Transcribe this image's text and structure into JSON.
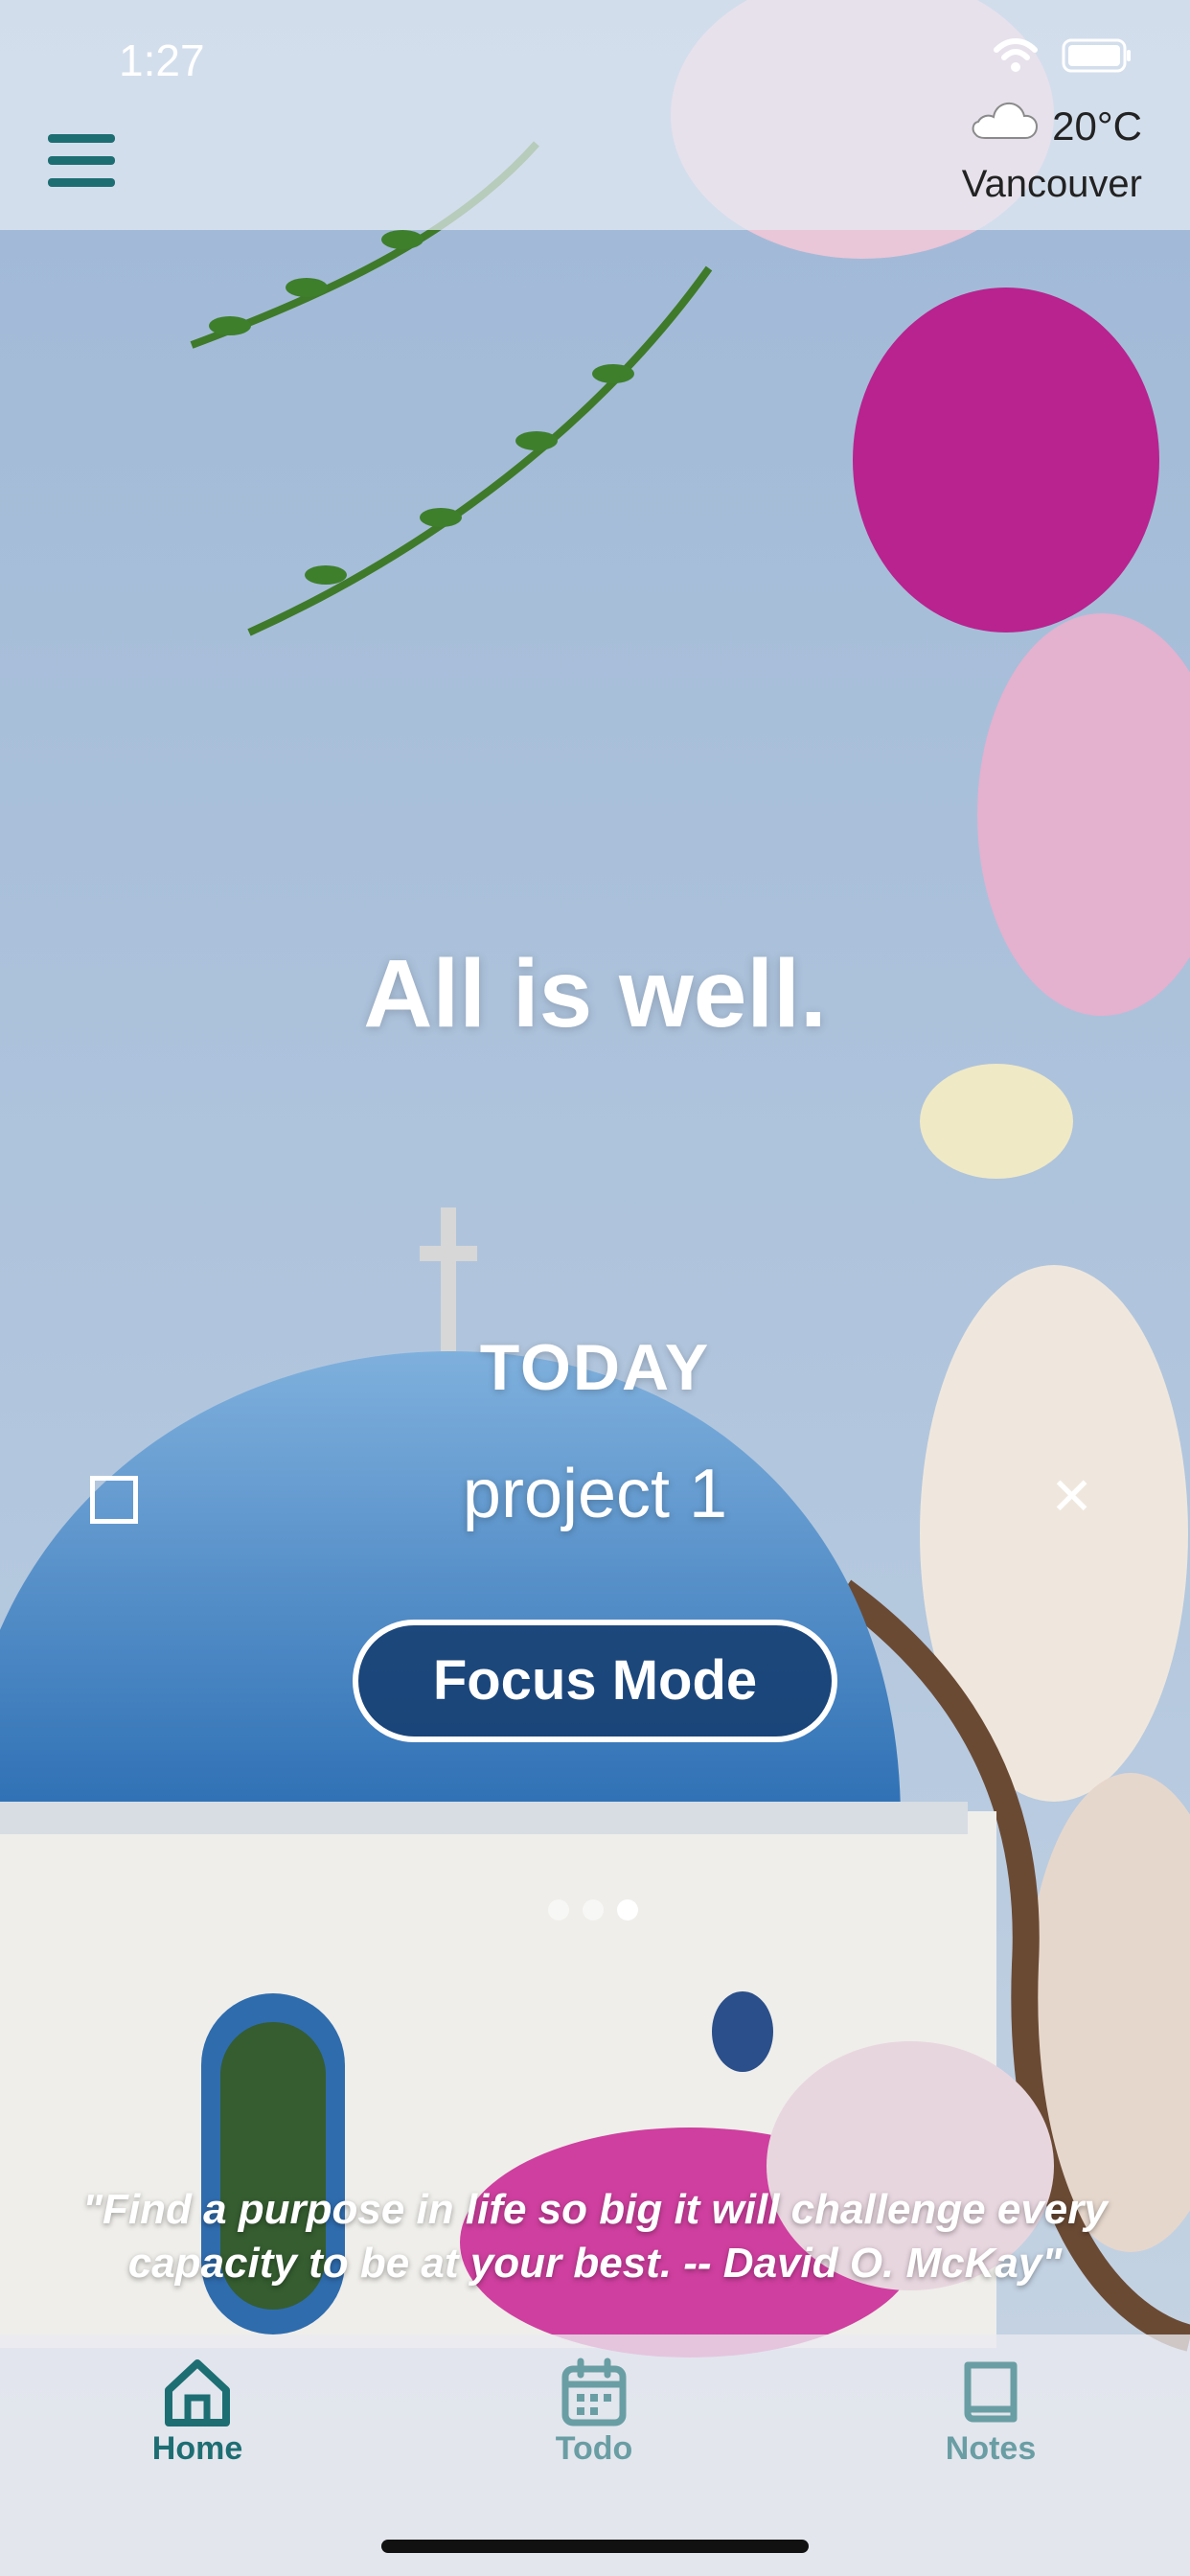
{
  "status_bar": {
    "time": "1:27"
  },
  "weather": {
    "temperature": "20°C",
    "city": "Vancouver",
    "icon": "cloud-icon"
  },
  "main": {
    "greeting": "All is well.",
    "today_label": "TODAY",
    "task": {
      "text": "project 1",
      "checked": false
    },
    "focus_button": "Focus Mode",
    "pagination": {
      "total": 3,
      "active": 3
    }
  },
  "quote": "\"Find a purpose in life so big it will challenge every capacity to be at your best. -- David O. McKay\"",
  "bottom_nav": [
    {
      "label": "Home",
      "icon": "home-icon",
      "active": true
    },
    {
      "label": "Todo",
      "icon": "calendar-icon",
      "active": false
    },
    {
      "label": "Notes",
      "icon": "book-icon",
      "active": false
    }
  ],
  "colors": {
    "accent": "#1d6e73",
    "button_fill": "#143c6e"
  }
}
